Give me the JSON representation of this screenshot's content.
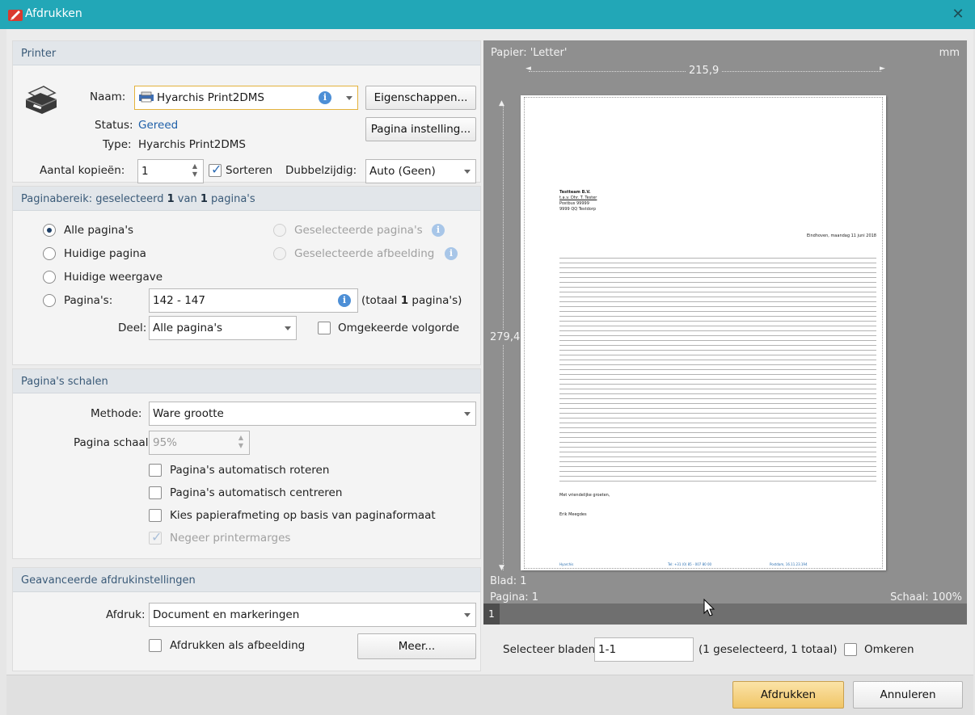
{
  "window": {
    "title": "Afdrukken",
    "close_glyph": "✕",
    "accent": "#22a7b7"
  },
  "printer": {
    "header": "Printer",
    "name_label": "Naam:",
    "name_value": "Hyarchis Print2DMS",
    "properties_button": "Eigenschappen...",
    "page_setup_button": "Pagina instelling...",
    "status_label": "Status:",
    "status_value": "Gereed",
    "type_label": "Type:",
    "type_value": "Hyarchis Print2DMS",
    "copies_label": "Aantal kopieën:",
    "copies_value": "1",
    "collate_label": "Sorteren",
    "duplex_label": "Dubbelzijdig:",
    "duplex_value": "Auto (Geen)"
  },
  "range": {
    "header_pre": "Paginabereik: geselecteerd ",
    "header_sel": "1",
    "header_mid": " van ",
    "header_total": "1",
    "header_post": " pagina's",
    "all_pages": "Alle pagina's",
    "current_page": "Huidige pagina",
    "current_view": "Huidige weergave",
    "pages_label": "Pagina's:",
    "pages_value": "142 - 147",
    "pages_total_pre": "(totaal ",
    "pages_total_num": "1",
    "pages_total_post": " pagina's)",
    "selected_pages": "Geselecteerde pagina's",
    "selected_image": "Geselecteerde afbeelding",
    "part_label": "Deel:",
    "part_value": "Alle pagina's",
    "reverse_label": "Omgekeerde volgorde"
  },
  "scale": {
    "header": "Pagina's schalen",
    "method_label": "Methode:",
    "method_value": "Ware grootte",
    "page_scale_label": "Pagina schaal:",
    "page_scale_value": "95%",
    "auto_rotate": "Pagina's automatisch roteren",
    "auto_center": "Pagina's automatisch centreren",
    "paper_by_size": "Kies papierafmeting op basis van paginaformaat",
    "ignore_margins": "Negeer printermarges"
  },
  "advanced": {
    "header": "Geavanceerde afdrukinstellingen",
    "print_label": "Afdruk:",
    "print_value": "Document en markeringen",
    "as_image": "Afdrukken als afbeelding",
    "more_button": "Meer..."
  },
  "preview": {
    "paper_label": "Papier: 'Letter'",
    "unit": "mm",
    "width": "215,9",
    "height": "279,4",
    "sheet": "Blad: 1",
    "page": "Pagina: 1",
    "scale": "Schaal: 100%",
    "thumb_page": "1",
    "doc": {
      "company": "Testteam B.V.",
      "attn": "t.a.v. Dhr. T. Tester",
      "pobox": "Postbus 99999",
      "city": "9999 QQ  Testdorp",
      "date": "Eindhoven, maandag 11 juni 2018",
      "closing": "Met vriendelijke groeten,",
      "signer": "Erik Meegdes",
      "footer_left": "Hyarchis",
      "footer_mid": "Tel: +31 (0) 85 - 007 80 00",
      "footer_right": "Postdam, 16.11.23.194"
    }
  },
  "select_sheets": {
    "label": "Selecteer bladen:",
    "value": "1-1",
    "summary": "(1 geselecteerd, 1 totaal)",
    "invert": "Omkeren"
  },
  "footer": {
    "print_button": "Afdrukken",
    "cancel_button": "Annuleren"
  }
}
